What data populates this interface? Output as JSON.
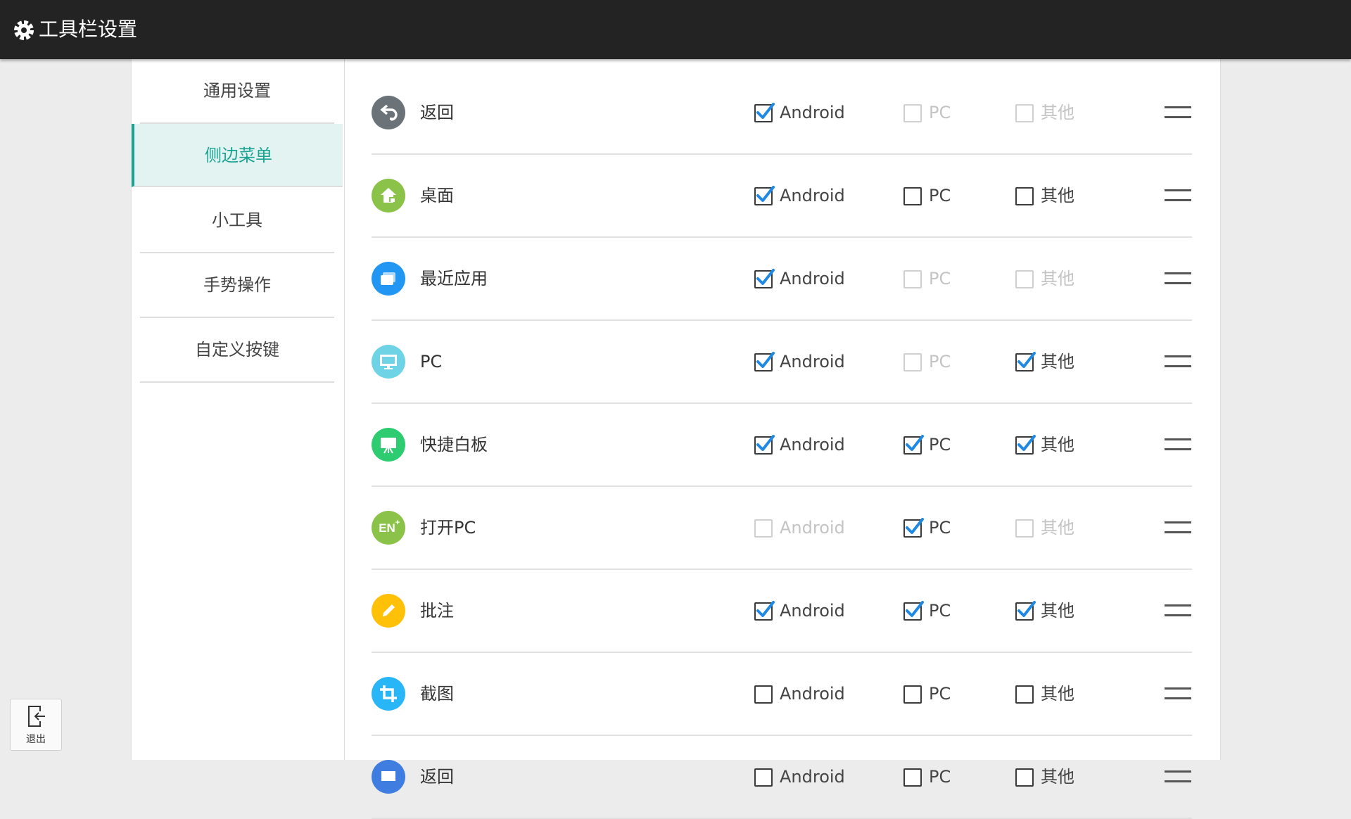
{
  "app": {
    "title": "工具栏设置",
    "icon": "gear-icon"
  },
  "sidebar": {
    "items": [
      {
        "label": "通用设置",
        "active": false
      },
      {
        "label": "侧边菜单",
        "active": true
      },
      {
        "label": "小工具",
        "active": false
      },
      {
        "label": "手势操作",
        "active": false
      },
      {
        "label": "自定义按键",
        "active": false
      }
    ]
  },
  "options": {
    "android": "Android",
    "pc": "PC",
    "other": "其他"
  },
  "colors": {
    "accent": "#1aa392",
    "check": "#1e88e5",
    "titlebar": "#232323"
  },
  "rows": [
    {
      "name": "返回",
      "icon": "back-icon",
      "icon_color": "#6b7378",
      "android": {
        "checked": true,
        "disabled": false
      },
      "pc": {
        "checked": false,
        "disabled": true
      },
      "other": {
        "checked": false,
        "disabled": true
      }
    },
    {
      "name": "桌面",
      "icon": "home-icon",
      "icon_color": "#8bc34a",
      "android": {
        "checked": true,
        "disabled": false
      },
      "pc": {
        "checked": false,
        "disabled": false
      },
      "other": {
        "checked": false,
        "disabled": false
      }
    },
    {
      "name": "最近应用",
      "icon": "recent-apps-icon",
      "icon_color": "#2196f3",
      "android": {
        "checked": true,
        "disabled": false
      },
      "pc": {
        "checked": false,
        "disabled": true
      },
      "other": {
        "checked": false,
        "disabled": true
      }
    },
    {
      "name": "PC",
      "icon": "monitor-icon",
      "icon_color": "#6fd3e6",
      "android": {
        "checked": true,
        "disabled": false
      },
      "pc": {
        "checked": false,
        "disabled": true
      },
      "other": {
        "checked": true,
        "disabled": false
      }
    },
    {
      "name": "快捷白板",
      "icon": "whiteboard-icon",
      "icon_color": "#2ecc71",
      "android": {
        "checked": true,
        "disabled": false
      },
      "pc": {
        "checked": true,
        "disabled": false
      },
      "other": {
        "checked": true,
        "disabled": false
      }
    },
    {
      "name": "打开PC",
      "icon": "open-pc-icon",
      "icon_color": "#8bc34a",
      "android": {
        "checked": false,
        "disabled": true
      },
      "pc": {
        "checked": true,
        "disabled": false
      },
      "other": {
        "checked": false,
        "disabled": true
      }
    },
    {
      "name": "批注",
      "icon": "pencil-icon",
      "icon_color": "#ffc107",
      "android": {
        "checked": true,
        "disabled": false
      },
      "pc": {
        "checked": true,
        "disabled": false
      },
      "other": {
        "checked": true,
        "disabled": false
      }
    },
    {
      "name": "截图",
      "icon": "crop-icon",
      "icon_color": "#29b6f6",
      "android": {
        "checked": false,
        "disabled": false
      },
      "pc": {
        "checked": false,
        "disabled": false
      },
      "other": {
        "checked": false,
        "disabled": false
      }
    },
    {
      "name": "返回",
      "icon": "partial-icon",
      "icon_color": "#3f7de0",
      "android": {
        "checked": false,
        "disabled": false
      },
      "pc": {
        "checked": false,
        "disabled": false
      },
      "other": {
        "checked": false,
        "disabled": false
      }
    }
  ],
  "exit": {
    "label": "退出"
  }
}
